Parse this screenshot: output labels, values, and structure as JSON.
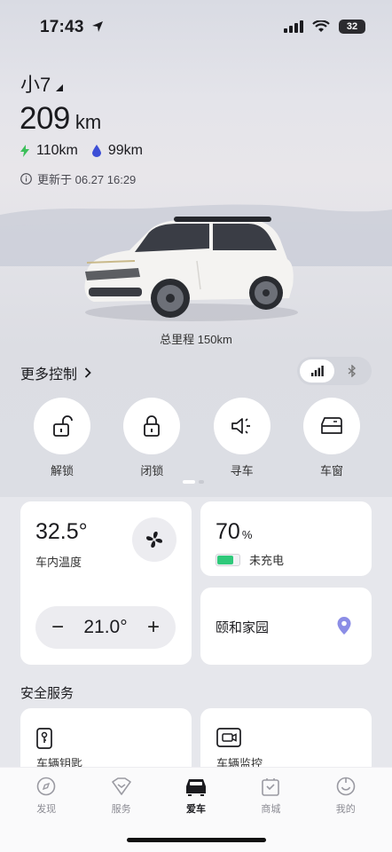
{
  "status_bar": {
    "time": "17:43",
    "battery": "32"
  },
  "vehicle": {
    "name": "小7",
    "range_value": "209",
    "range_unit": "km",
    "electric_range": "110km",
    "fuel_range": "99km",
    "updated": "更新于 06.27 16:29",
    "odometer": "总里程 150km"
  },
  "controls_header": {
    "more_control": "更多控制"
  },
  "quick_controls": [
    {
      "label": "解锁",
      "icon": "unlock-icon"
    },
    {
      "label": "闭锁",
      "icon": "lock-icon"
    },
    {
      "label": "寻车",
      "icon": "find-car-horn-icon"
    },
    {
      "label": "车窗",
      "icon": "window-icon"
    }
  ],
  "climate": {
    "cabin_temp": "32.5°",
    "cabin_temp_label": "车内温度",
    "set_temp": "21.0°",
    "minus": "−",
    "plus": "+"
  },
  "battery": {
    "percent": "70",
    "percent_unit": "%",
    "level": 0.7,
    "status": "未充电",
    "color": "#2fc97a"
  },
  "location": {
    "name": "颐和家园"
  },
  "safety": {
    "title": "安全服务",
    "items": [
      {
        "label": "车辆钥匙",
        "icon": "car-key-icon"
      },
      {
        "label": "车辆监控",
        "icon": "camera-monitor-icon"
      }
    ]
  },
  "tabbar": {
    "items": [
      {
        "label": "发现",
        "icon": "compass-icon"
      },
      {
        "label": "服务",
        "icon": "service-heart-icon"
      },
      {
        "label": "爱车",
        "icon": "car-icon"
      },
      {
        "label": "商城",
        "icon": "mall-bag-icon"
      },
      {
        "label": "我的",
        "icon": "profile-smile-icon"
      }
    ],
    "active": 2
  },
  "colors": {
    "accent_electric": "#3cbf5a",
    "accent_fuel": "#3d4fd6",
    "location_pin": "#8b8de6"
  }
}
